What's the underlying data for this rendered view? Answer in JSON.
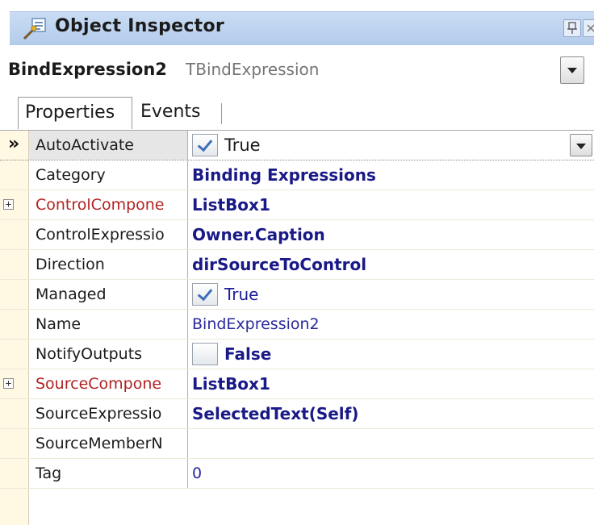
{
  "window": {
    "title": "Object Inspector"
  },
  "object_selector": {
    "name": "BindExpression2",
    "type": "TBindExpression"
  },
  "tabs": [
    {
      "label": "Properties"
    },
    {
      "label": "Events"
    }
  ],
  "selected_marker": "»",
  "properties": [
    {
      "name": "AutoActivate",
      "value": "True"
    },
    {
      "name": "Category",
      "value": "Binding Expressions"
    },
    {
      "name": "ControlCompone",
      "value": "ListBox1"
    },
    {
      "name": "ControlExpressio",
      "value": "Owner.Caption"
    },
    {
      "name": "Direction",
      "value": "dirSourceToControl"
    },
    {
      "name": "Managed",
      "value": "True"
    },
    {
      "name": "Name",
      "value": "BindExpression2"
    },
    {
      "name": "NotifyOutputs",
      "value": "False"
    },
    {
      "name": "SourceCompone",
      "value": "ListBox1"
    },
    {
      "name": "SourceExpressio",
      "value": "SelectedText(Self)"
    },
    {
      "name": "SourceMemberN",
      "value": ""
    },
    {
      "name": "Tag",
      "value": "0"
    }
  ],
  "colors": {
    "title_bar": "#b3cbeb",
    "gutter": "#fff8e2",
    "reference_property": "#b22222",
    "value_text": "#191987"
  }
}
